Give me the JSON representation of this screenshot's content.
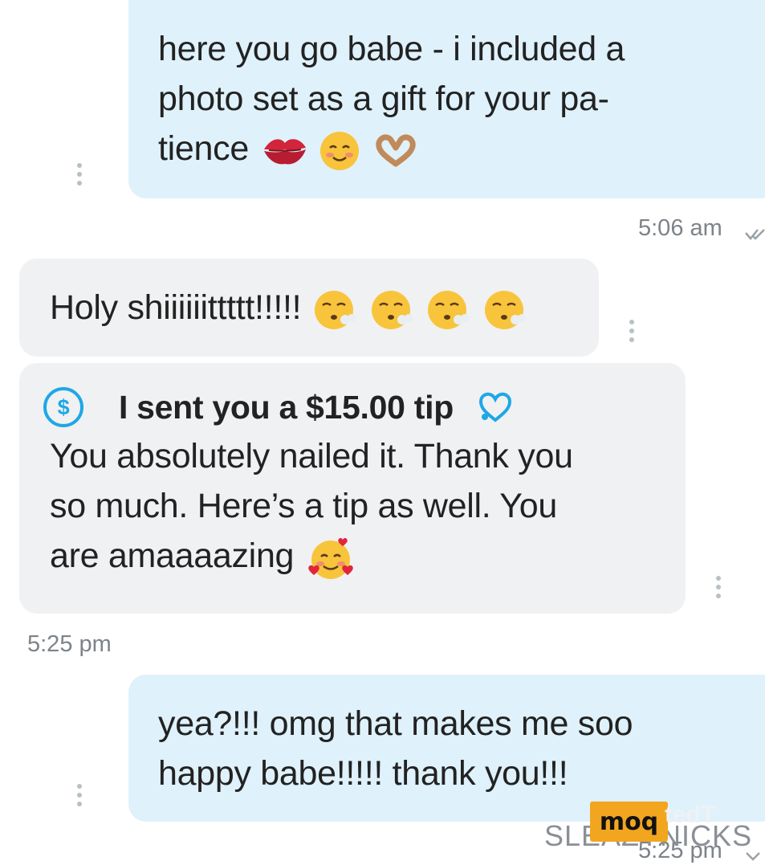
{
  "messages": [
    {
      "direction": "outgoing",
      "text_lines": [
        "here you go babe - i included a",
        "photo set as a gift for your pa-",
        "tience"
      ],
      "emojis": [
        "kiss-mark",
        "smiling-face-blushing",
        "heart-hands"
      ],
      "time": "5:06 am"
    },
    {
      "direction": "incoming",
      "text": "Holy shiiiiiittttt!!!!!",
      "emojis": [
        "face-exhaling",
        "face-exhaling",
        "face-exhaling",
        "face-exhaling"
      ]
    },
    {
      "direction": "incoming",
      "tip_label": "I sent you a $15.00 tip",
      "tip_icon": "dollar-circle-icon",
      "text_lines": [
        "You absolutely nailed it. Thank you",
        "so much. Here’s a tip as well. You",
        "are amaaaazing"
      ],
      "emojis": [
        "smiling-face-with-hearts"
      ],
      "time": "5:25 pm"
    },
    {
      "direction": "outgoing",
      "text_lines": [
        "yea?!!! omg that makes me soo",
        "happy babe!!!!! thank you!!!"
      ],
      "time": "5:25 pm"
    }
  ],
  "watermark": {
    "badge": "moq",
    "text": "SLEAZYNICKS",
    "faint": "tedT"
  },
  "colors": {
    "outgoing_bubble": "#dff1fb",
    "incoming_bubble": "#f0f1f3",
    "accent": "#1fa7e6",
    "timestamp": "#7d8389"
  }
}
